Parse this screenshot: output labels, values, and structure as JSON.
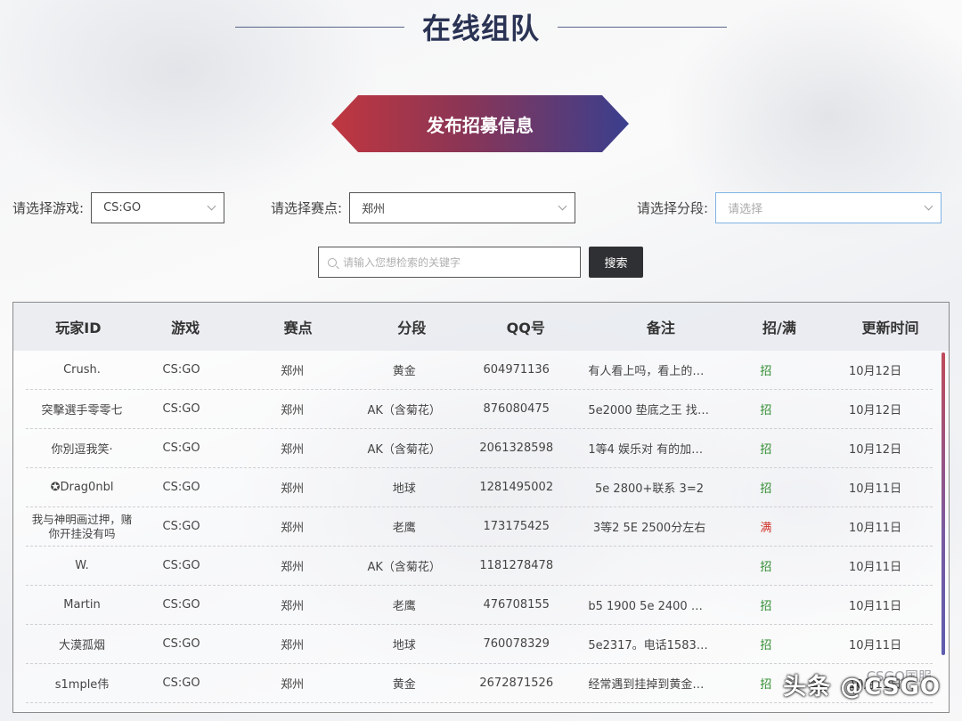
{
  "page": {
    "title": "在线组队",
    "publish_label": "发布招募信息"
  },
  "filters": {
    "game_label": "请选择游戏:",
    "game_value": "CS:GO",
    "venue_label": "请选择赛点:",
    "venue_value": "郑州",
    "rank_label": "请选择分段:",
    "rank_placeholder": "请选择"
  },
  "search": {
    "placeholder": "请输入您想检索的关键字",
    "button_label": "搜索"
  },
  "table": {
    "headers": [
      "玩家ID",
      "游戏",
      "赛点",
      "分段",
      "QQ号",
      "备注",
      "招/满",
      "更新时间"
    ],
    "rows": [
      {
        "id": "Crush.",
        "game": "CS:GO",
        "venue": "郑州",
        "rank": "黄金",
        "qq": "604971136",
        "note": "有人看上吗，看上的联…",
        "status": "招",
        "updated": "10月12日"
      },
      {
        "id": "突擊選手零零七",
        "game": "CS:GO",
        "venue": "郑州",
        "rank": "AK（含菊花）",
        "qq": "876080475",
        "note": "5e2000 垫底之王 找娱…",
        "status": "招",
        "updated": "10月12日"
      },
      {
        "id": "你別逗我笑·",
        "game": "CS:GO",
        "venue": "郑州",
        "rank": "AK（含菊花）",
        "qq": "2061328598",
        "note": "1等4 娱乐对 有的加我 …",
        "status": "招",
        "updated": "10月12日"
      },
      {
        "id": "✪Drag0nbl",
        "game": "CS:GO",
        "venue": "郑州",
        "rank": "地球",
        "qq": "1281495002",
        "note": "5e 2800+联系 3=2",
        "status": "招",
        "updated": "10月11日"
      },
      {
        "id": "我与神明画过押，赌你开挂没有吗",
        "game": "CS:GO",
        "venue": "郑州",
        "rank": "老鹰",
        "qq": "173175425",
        "note": "3等2 5E 2500分左右",
        "status": "满",
        "updated": "10月11日"
      },
      {
        "id": "W.",
        "game": "CS:GO",
        "venue": "郑州",
        "rank": "AK（含菊花）",
        "qq": "1181278478",
        "note": "",
        "status": "招",
        "updated": "10月11日"
      },
      {
        "id": "Martin",
        "game": "CS:GO",
        "venue": "郑州",
        "rank": "老鹰",
        "qq": "476708155",
        "note": "b5 1900 5e 2400 求组 …",
        "status": "招",
        "updated": "10月11日"
      },
      {
        "id": "大漠孤烟",
        "game": "CS:GO",
        "venue": "郑州",
        "rank": "地球",
        "qq": "760078329",
        "note": "5e2317。电话1583796…",
        "status": "招",
        "updated": "10月11日"
      },
      {
        "id": "s1mple伟",
        "game": "CS:GO",
        "venue": "郑州",
        "rank": "黄金",
        "qq": "2672871526",
        "note": "经常遇到挂掉到黄金了…",
        "status": "招",
        "updated": "10月11日"
      }
    ]
  },
  "watermark": {
    "text": "头条 @CSGO",
    "sub": "CSGO国服"
  },
  "colors": {
    "recruit": "#2e8b2e",
    "full": "#d0342c",
    "accent_left": "#c0373f",
    "accent_right": "#3a3f8e"
  }
}
